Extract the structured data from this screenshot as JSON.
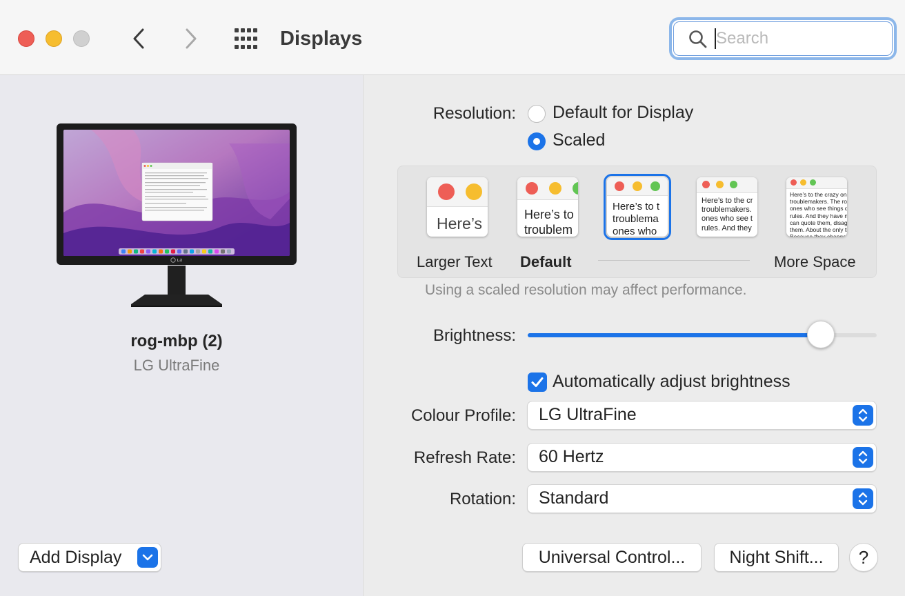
{
  "window": {
    "title": "Displays"
  },
  "search": {
    "placeholder": "Search",
    "value": ""
  },
  "display": {
    "name": "rog-mbp (2)",
    "model": "LG UltraFine",
    "brand": "LG"
  },
  "add_display": {
    "label": "Add Display"
  },
  "resolution": {
    "label": "Resolution:",
    "options": [
      "Default for Display",
      "Scaled"
    ],
    "selected": "Scaled"
  },
  "scaling": {
    "labels": {
      "larger": "Larger Text",
      "default": "Default",
      "more": "More Space"
    },
    "thumbnails": [
      {
        "text": "Here’s"
      },
      {
        "text": "Here’s to\ntroublem"
      },
      {
        "text": "Here’s to t\ntroublema\nones who"
      },
      {
        "text": "Here’s to the cr\ntroublemakers.\nones who see t\nrules. And they"
      },
      {
        "text": "Here’s to the crazy ones\ntroublemakers. The rou\nones who see things dif\nrules. And they have no\ncan quote them, disagre\nthem. About the only th\nBecause they change th"
      }
    ],
    "selected_index": 2,
    "note": "Using a scaled resolution may affect performance."
  },
  "brightness": {
    "label": "Brightness:",
    "level": 0.84
  },
  "auto_brightness": {
    "label": "Automatically adjust brightness",
    "checked": true
  },
  "colour_profile": {
    "label": "Colour Profile:",
    "value": "LG UltraFine"
  },
  "refresh_rate": {
    "label": "Refresh Rate:",
    "value": "60 Hertz"
  },
  "rotation": {
    "label": "Rotation:",
    "value": "Standard"
  },
  "buttons": {
    "universal_control": "Universal Control...",
    "night_shift": "Night Shift...",
    "help": "?"
  },
  "colors": {
    "accent": "#1b73e8",
    "close": "#ee5e56",
    "minimize": "#f6bd2f",
    "zoom": "#d0d0d0"
  }
}
